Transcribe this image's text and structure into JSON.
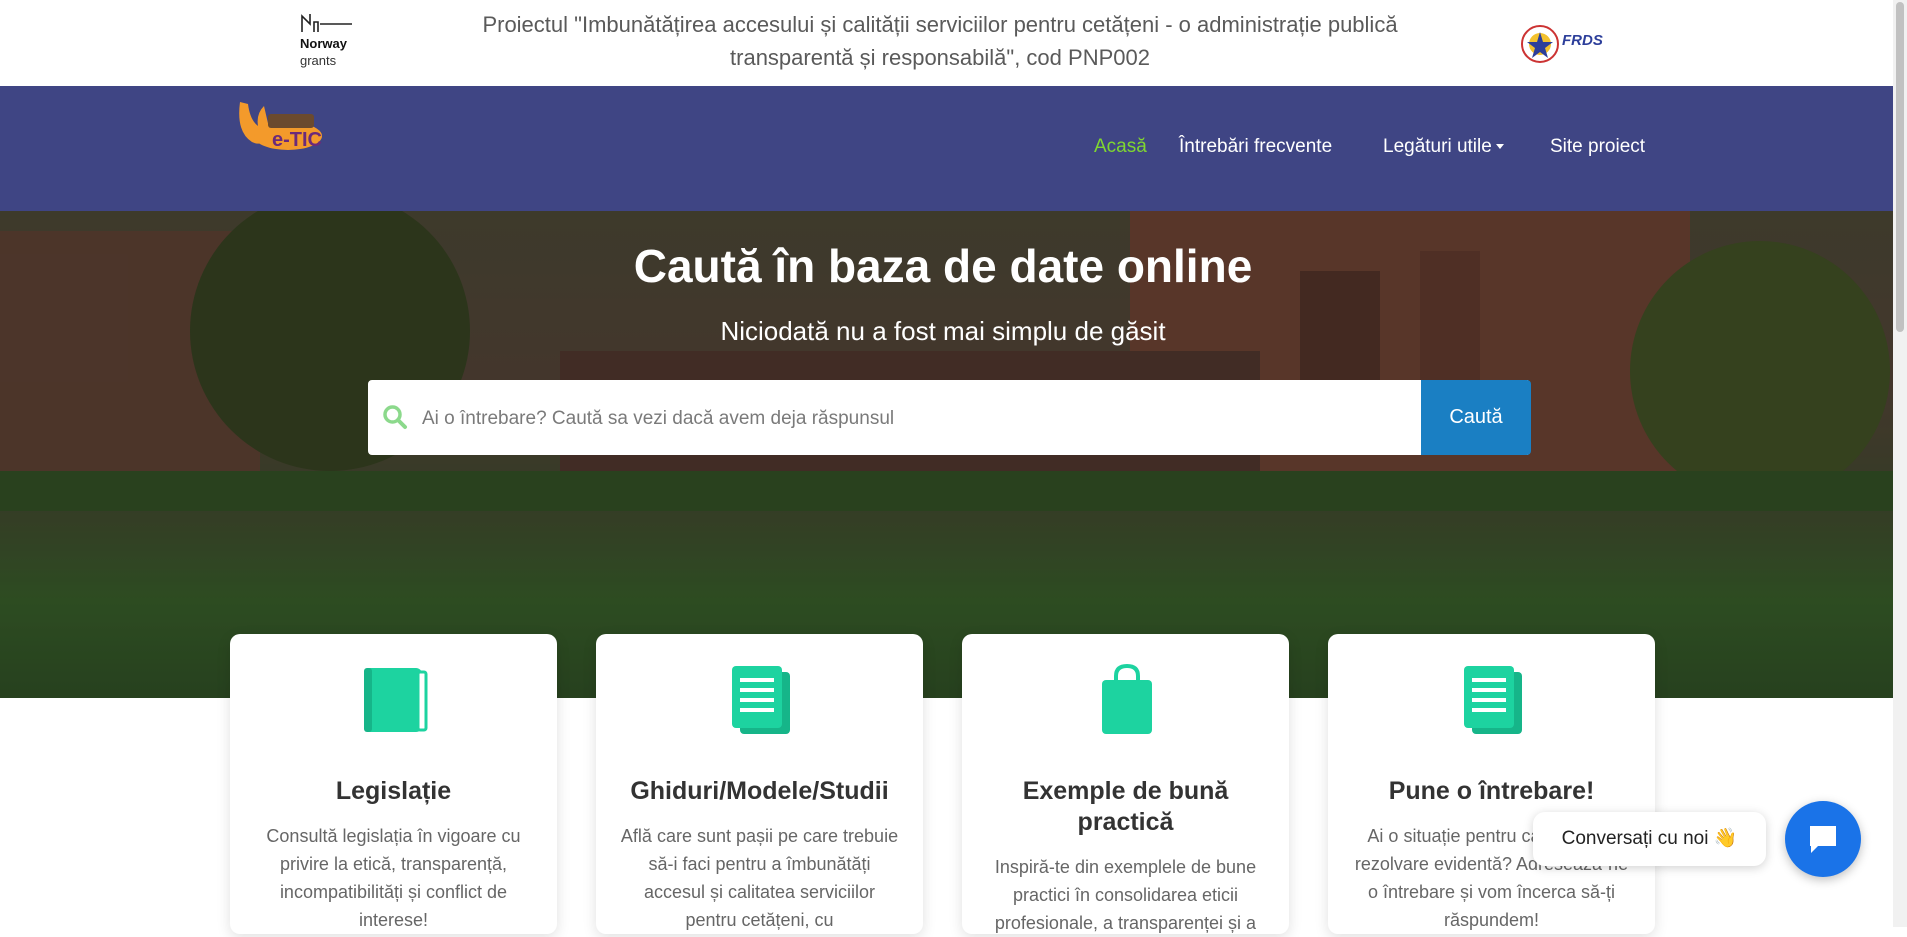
{
  "topbar": {
    "norway_line1": "Norway",
    "norway_line2": "grants",
    "project_text": "Proiectul \"Imbunătățirea accesului și calității serviciilor pentru cetățeni - o administrație publică transparentă și responsabilă\", cod PNP002",
    "frds_label": "FRDS"
  },
  "nav": {
    "logo_text": "e-TIC",
    "items": [
      {
        "label": "Acasă",
        "active": true
      },
      {
        "label": "Întrebări frecvente"
      },
      {
        "label": "Legături utile"
      },
      {
        "label": "Site proiect"
      }
    ]
  },
  "hero": {
    "title": "Caută în baza de date online",
    "subtitle": "Niciodată nu a fost mai simplu de găsit",
    "search_placeholder": "Ai o întrebare? Caută sa vezi dacă avem deja răspunsul",
    "search_button": "Caută"
  },
  "cards": [
    {
      "icon": "book-icon",
      "title": "Legislație",
      "text": "Consultă legislația în vigoare cu privire la etică, transparență, incompatibilități și conflict de interese!"
    },
    {
      "icon": "document-icon",
      "title": "Ghiduri/Modele/Studii",
      "text": "Află care sunt pașii pe care trebuie să-i faci pentru a îmbunătăți accesul și calitatea serviciilor pentru cetățeni, cu"
    },
    {
      "icon": "shopping-bag-icon",
      "title": "Exemple de bună practică",
      "text": "Inspiră-te din exemplele de bune practici în consolidarea eticii profesionale, a transparenței și a"
    },
    {
      "icon": "document-icon",
      "title": "Pune o întrebare!",
      "text": "Ai o situație pentru care nu ai o rezolvare evidentă? Adresează-ne o întrebare și vom încerca să-ți răspundem!"
    }
  ],
  "chat": {
    "bubble_text": "Conversați cu noi 👋"
  },
  "colors": {
    "nav_bg": "#3f4584",
    "active": "#7fd630",
    "accent": "#1a7fc3",
    "card_icon": "#1dd3a0"
  }
}
